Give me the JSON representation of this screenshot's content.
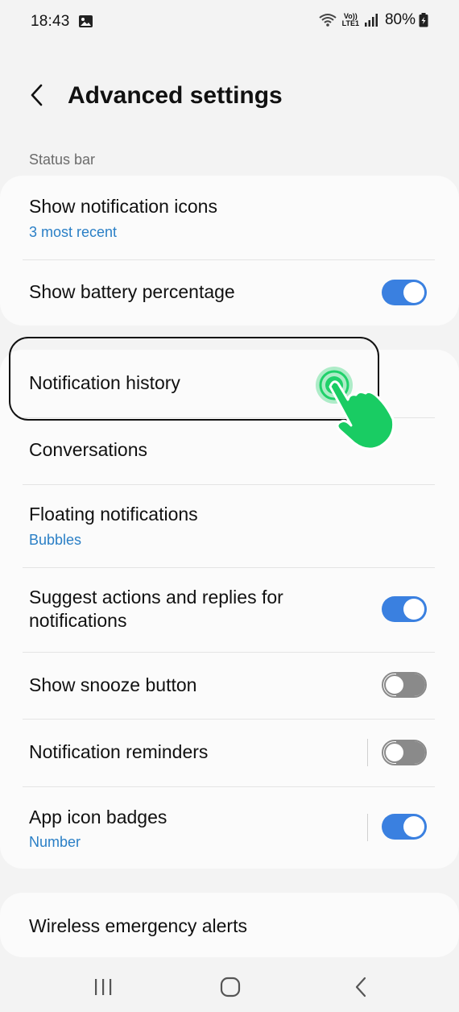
{
  "status_bar": {
    "time": "18:43",
    "volte_top": "Vo))",
    "volte_bottom": "LTE1",
    "battery": "80%",
    "icons": [
      "gallery-icon",
      "wifi-icon",
      "volte-icon",
      "signal-icon",
      "battery-charging-icon"
    ]
  },
  "header": {
    "title": "Advanced settings",
    "back_icon": "chevron-left-icon"
  },
  "section_status_bar": "Status bar",
  "status_bar_card": {
    "items": [
      {
        "title": "Show notification icons",
        "subtitle": "3 most recent"
      },
      {
        "title": "Show battery percentage",
        "toggle": true
      }
    ]
  },
  "notifications_card": {
    "items": [
      {
        "title": "Notification history"
      },
      {
        "title": "Conversations"
      },
      {
        "title": "Floating notifications",
        "subtitle": "Bubbles"
      },
      {
        "title_line1": "Suggest actions and replies for",
        "title_line2": "notifications",
        "toggle": true
      },
      {
        "title": "Show snooze button",
        "toggle": false
      },
      {
        "title": "Notification reminders",
        "toggle": false
      },
      {
        "title": "App icon badges",
        "subtitle": "Number",
        "toggle": true
      }
    ]
  },
  "alerts_card": {
    "items": [
      {
        "title": "Wireless emergency alerts"
      }
    ]
  },
  "nav_bar": {
    "icons": [
      "recent-apps-icon",
      "home-icon",
      "back-icon"
    ]
  },
  "colors": {
    "background": "#f3f3f3",
    "card": "#fbfbfb",
    "accent_blue": "#3a80e0",
    "subtitle_blue": "#2a7fc6",
    "tap_indicator_green": "#1fd16a"
  }
}
